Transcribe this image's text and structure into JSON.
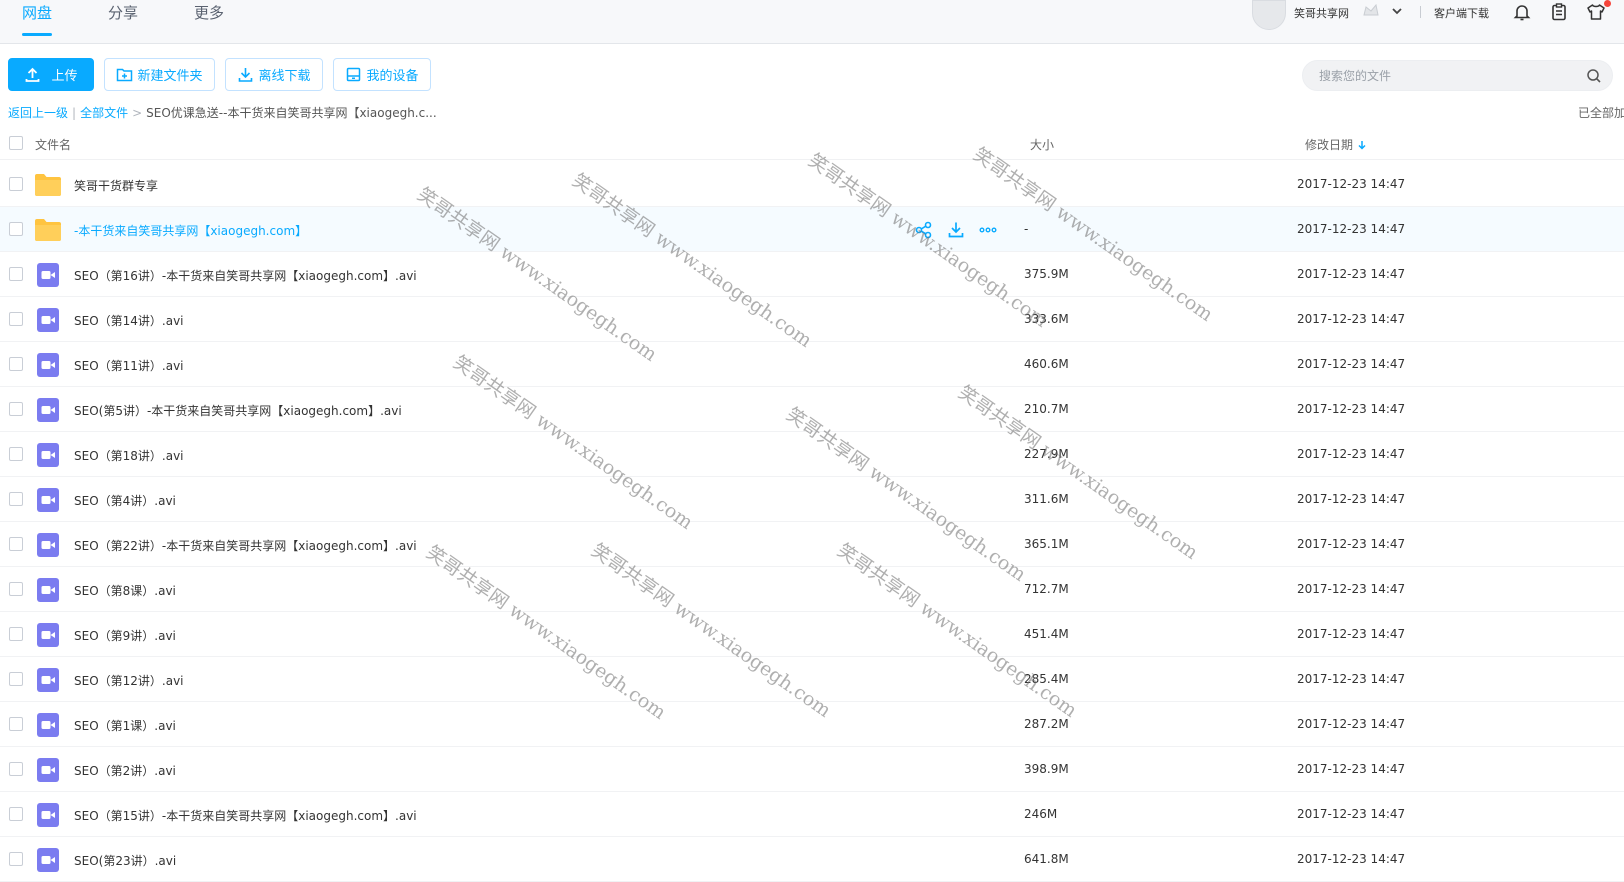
{
  "nav": {
    "tabs": [
      {
        "label": "网盘",
        "active": true
      },
      {
        "label": "分享",
        "active": false
      },
      {
        "label": "更多",
        "active": false
      }
    ],
    "username": "笑哥共享网",
    "client_download": "客户端下载"
  },
  "toolbar": {
    "upload": "上传",
    "new_folder": "新建文件夹",
    "offline_download": "离线下载",
    "my_devices": "我的设备"
  },
  "search": {
    "placeholder": "搜索您的文件"
  },
  "breadcrumb": {
    "back": "返回上一级",
    "all_files": "全部文件",
    "separator": ">",
    "current": "SEO优课急送--本干货来自笑哥共享网【xiaogegh.c..."
  },
  "loaded_status": "已全部加载",
  "table": {
    "headers": {
      "name": "文件名",
      "size": "大小",
      "date": "修改日期"
    },
    "rows": [
      {
        "type": "folder",
        "name": "笑哥干货群专享",
        "size": "",
        "date": "2017-12-23 14:47"
      },
      {
        "type": "folder",
        "name": "-本干货来自笑哥共享网【xiaogegh.com】",
        "size": "-",
        "date": "2017-12-23 14:47",
        "hovered": true
      },
      {
        "type": "video",
        "name": "SEO（第16讲）-本干货来自笑哥共享网【xiaogegh.com】.avi",
        "size": "375.9M",
        "date": "2017-12-23 14:47"
      },
      {
        "type": "video",
        "name": "SEO（第14讲）.avi",
        "size": "333.6M",
        "date": "2017-12-23 14:47"
      },
      {
        "type": "video",
        "name": "SEO（第11讲）.avi",
        "size": "460.6M",
        "date": "2017-12-23 14:47"
      },
      {
        "type": "video",
        "name": "SEO(第5讲）-本干货来自笑哥共享网【xiaogegh.com】.avi",
        "size": "210.7M",
        "date": "2017-12-23 14:47"
      },
      {
        "type": "video",
        "name": "SEO（第18讲）.avi",
        "size": "227.9M",
        "date": "2017-12-23 14:47"
      },
      {
        "type": "video",
        "name": "SEO（第4讲）.avi",
        "size": "311.6M",
        "date": "2017-12-23 14:47"
      },
      {
        "type": "video",
        "name": "SEO（第22讲）-本干货来自笑哥共享网【xiaogegh.com】.avi",
        "size": "365.1M",
        "date": "2017-12-23 14:47"
      },
      {
        "type": "video",
        "name": "SEO（第8课）.avi",
        "size": "712.7M",
        "date": "2017-12-23 14:47"
      },
      {
        "type": "video",
        "name": "SEO（第9讲）.avi",
        "size": "451.4M",
        "date": "2017-12-23 14:47"
      },
      {
        "type": "video",
        "name": "SEO（第12讲）.avi",
        "size": "285.4M",
        "date": "2017-12-23 14:47"
      },
      {
        "type": "video",
        "name": "SEO（第1课）.avi",
        "size": "287.2M",
        "date": "2017-12-23 14:47"
      },
      {
        "type": "video",
        "name": "SEO（第2讲）.avi",
        "size": "398.9M",
        "date": "2017-12-23 14:47"
      },
      {
        "type": "video",
        "name": "SEO（第15讲）-本干货来自笑哥共享网【xiaogegh.com】.avi",
        "size": "246M",
        "date": "2017-12-23 14:47"
      },
      {
        "type": "video",
        "name": "SEO(第23讲）.avi",
        "size": "641.8M",
        "date": "2017-12-23 14:47"
      }
    ]
  },
  "watermark": "笑哥共享网 www.xiaogegh.com",
  "colors": {
    "accent": "#09aaff",
    "folder": "#ffc440",
    "video": "#7b7cf0"
  }
}
